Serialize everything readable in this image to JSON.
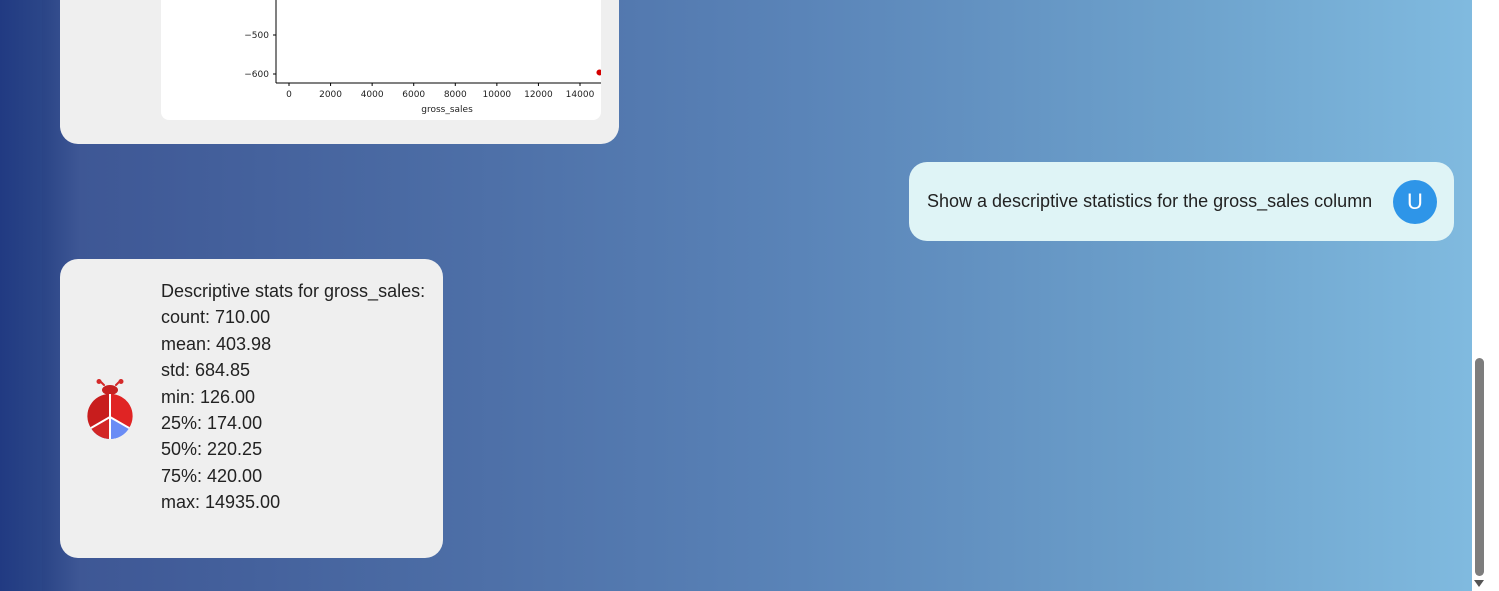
{
  "chart_data": {
    "type": "scatter",
    "xlabel": "gross_sales",
    "ylabel": "",
    "x_ticks": [
      "0",
      "2000",
      "4000",
      "6000",
      "8000",
      "10000",
      "12000",
      "14000"
    ],
    "y_ticks": [
      "−500",
      "−600"
    ],
    "points": [
      {
        "x": 14935,
        "y": -596
      }
    ],
    "point_color": "#d40000"
  },
  "user_message": {
    "text": "Show a descriptive statistics for the gross_sales column",
    "avatar_letter": "U"
  },
  "assistant_message": {
    "lines": [
      "Descriptive stats for gross_sales:",
      "count: 710.00",
      "mean: 403.98",
      "std: 684.85",
      "min: 126.00",
      "25%: 174.00",
      "50%: 220.25",
      "75%: 420.00",
      "max: 14935.00"
    ]
  }
}
